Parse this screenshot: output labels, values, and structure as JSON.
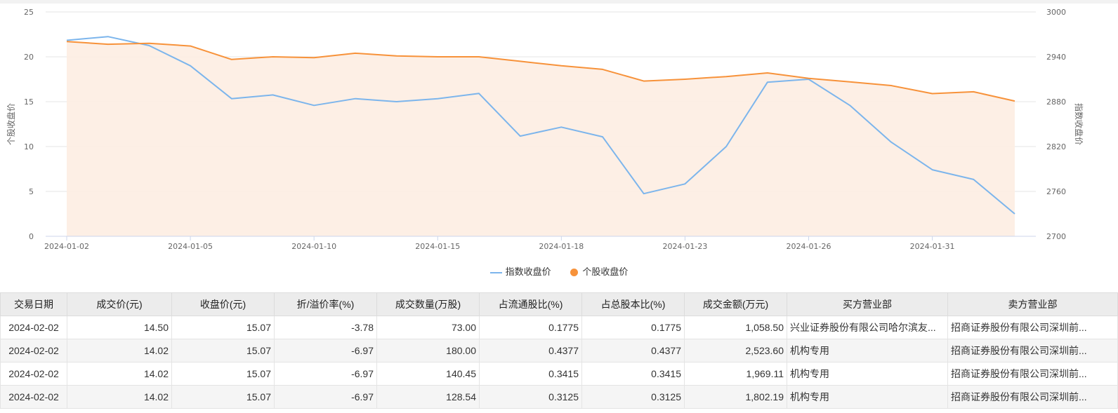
{
  "chart_data": {
    "type": "line",
    "categories": [
      "2024-01-02",
      "2024-01-03",
      "2024-01-04",
      "2024-01-05",
      "2024-01-08",
      "2024-01-09",
      "2024-01-10",
      "2024-01-11",
      "2024-01-12",
      "2024-01-15",
      "2024-01-16",
      "2024-01-17",
      "2024-01-18",
      "2024-01-19",
      "2024-01-22",
      "2024-01-23",
      "2024-01-24",
      "2024-01-25",
      "2024-01-26",
      "2024-01-29",
      "2024-01-30",
      "2024-01-31",
      "2024-02-01",
      "2024-02-02"
    ],
    "x_tick_labels": [
      "2024-01-02",
      "2024-01-05",
      "2024-01-10",
      "2024-01-15",
      "2024-01-18",
      "2024-01-23",
      "2024-01-26",
      "2024-01-31"
    ],
    "left_axis": {
      "label": "个股收盘价",
      "ylim": [
        0,
        25
      ],
      "ticks": [
        "0",
        "5",
        "10",
        "15",
        "20",
        "25"
      ]
    },
    "right_axis": {
      "label": "指数收盘价",
      "ylim": [
        2700,
        3000
      ],
      "ticks": [
        "2700",
        "2760",
        "2820",
        "2880",
        "2940",
        "3000"
      ]
    },
    "series": [
      {
        "name": "指数收盘价",
        "axis": "right",
        "color": "#7cb5ec",
        "style": "line",
        "values": [
          2962,
          2967,
          2955,
          2928,
          2884,
          2889,
          2875,
          2884,
          2880,
          2884,
          2891,
          2834,
          2846,
          2833,
          2757,
          2770,
          2820,
          2906,
          2910,
          2875,
          2826,
          2789,
          2776,
          2730
        ]
      },
      {
        "name": "个股收盘价",
        "axis": "left",
        "color": "#f7923a",
        "style": "area",
        "values": [
          21.7,
          21.4,
          21.5,
          21.2,
          19.7,
          20.0,
          19.9,
          20.4,
          20.1,
          20.0,
          20.0,
          19.5,
          19.0,
          18.6,
          17.3,
          17.5,
          17.8,
          18.2,
          17.6,
          17.2,
          16.8,
          15.9,
          16.1,
          15.07
        ]
      }
    ],
    "grid": true,
    "legend_position": "bottom-center"
  },
  "table": {
    "headers": [
      "交易日期",
      "成交价(元)",
      "收盘价(元)",
      "折/溢价率(%)",
      "成交数量(万股)",
      "占流通股比(%)",
      "占总股本比(%)",
      "成交金额(万元)",
      "买方营业部",
      "卖方营业部"
    ],
    "rows": [
      [
        "2024-02-02",
        "14.50",
        "15.07",
        "-3.78",
        "73.00",
        "0.1775",
        "0.1775",
        "1,058.50",
        "兴业证券股份有限公司哈尔滨友...",
        "招商证券股份有限公司深圳前..."
      ],
      [
        "2024-02-02",
        "14.02",
        "15.07",
        "-6.97",
        "180.00",
        "0.4377",
        "0.4377",
        "2,523.60",
        "机构专用",
        "招商证券股份有限公司深圳前..."
      ],
      [
        "2024-02-02",
        "14.02",
        "15.07",
        "-6.97",
        "140.45",
        "0.3415",
        "0.3415",
        "1,969.11",
        "机构专用",
        "招商证券股份有限公司深圳前..."
      ],
      [
        "2024-02-02",
        "14.02",
        "15.07",
        "-6.97",
        "128.54",
        "0.3125",
        "0.3125",
        "1,802.19",
        "机构专用",
        "招商证券股份有限公司深圳前..."
      ]
    ]
  }
}
